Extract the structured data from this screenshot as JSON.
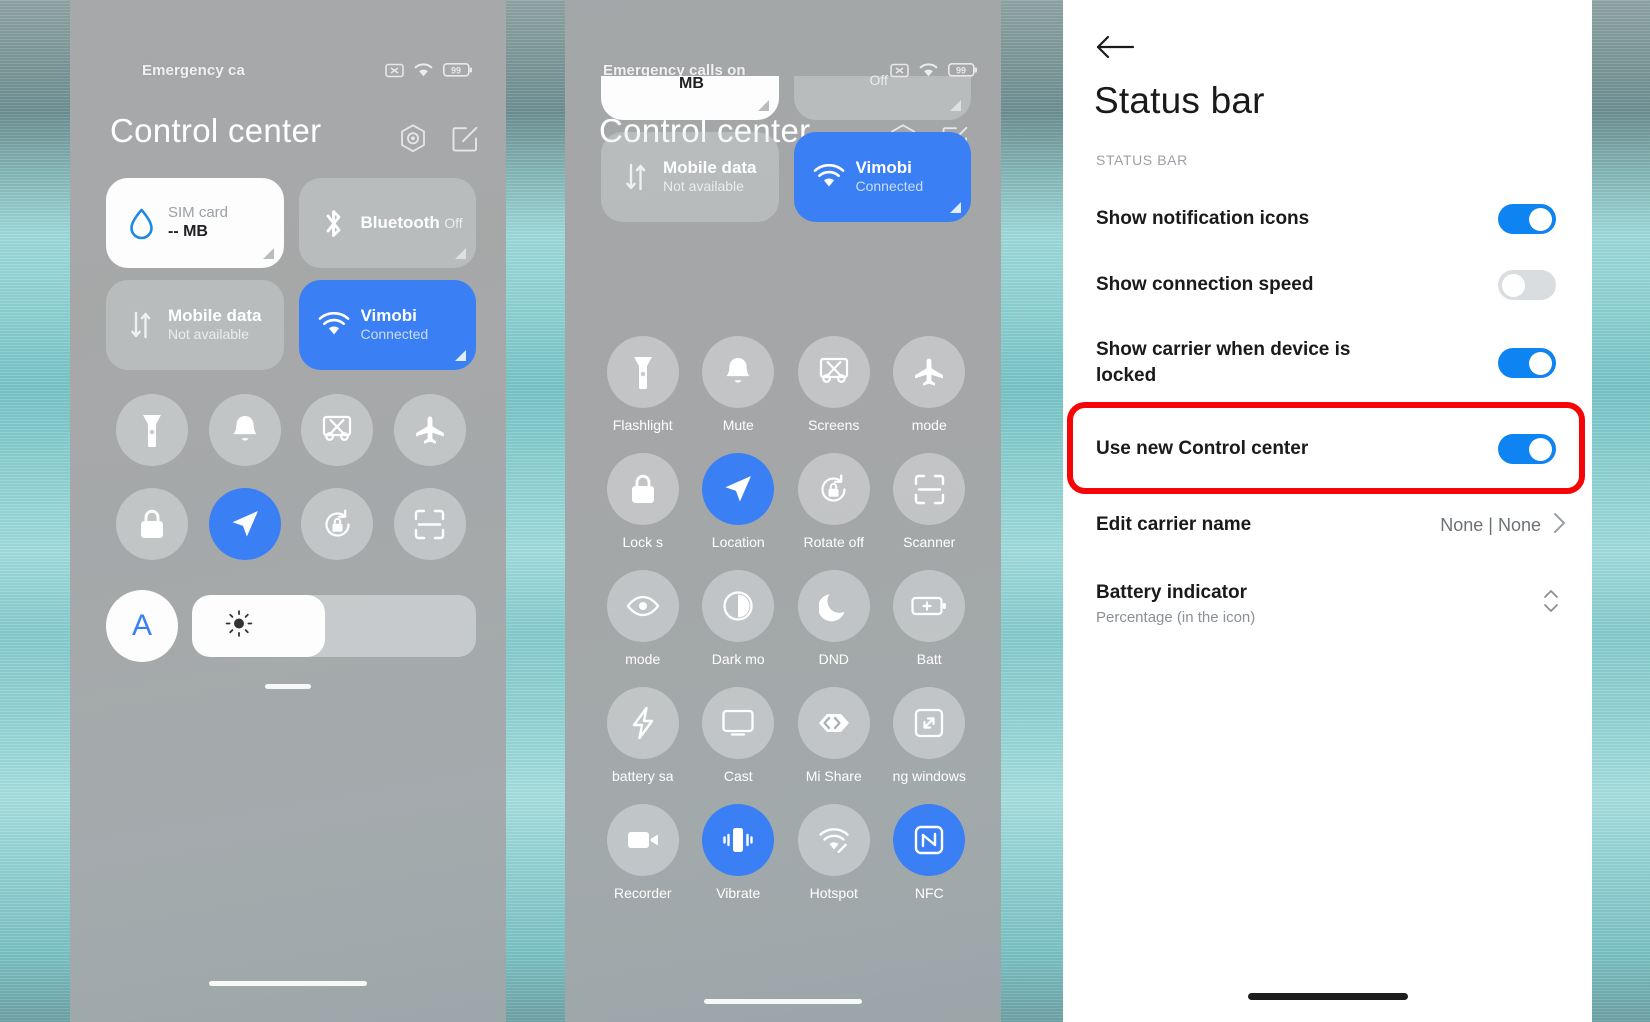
{
  "wallpaper": {
    "color_top": "#8fa5a5",
    "color_mid": "#8fd3d4",
    "color_bottom": "#6fa3a6"
  },
  "accent": {
    "blue": "#3b7ff5",
    "toggle_blue": "#0d84f2",
    "highlight_red": "#f50505"
  },
  "phone1": {
    "status_bar": {
      "carrier": "Emergency ca",
      "battery": "99",
      "icons": [
        "sim-off-icon",
        "wifi-icon",
        "battery-icon"
      ]
    },
    "header": {
      "title": "Control center",
      "icons": [
        "settings-hex-icon",
        "edit-icon"
      ]
    },
    "big_tiles": [
      {
        "title": "SIM card",
        "subtitle": "-- MB",
        "icon": "data-drop-icon",
        "state": "white"
      },
      {
        "title": "Bluetooth",
        "subtitle": "Off",
        "icon": "bluetooth-icon",
        "state": "dim"
      },
      {
        "title": "Mobile data",
        "subtitle": "Not available",
        "icon": "mobile-data-icon",
        "state": "dim"
      },
      {
        "title": "Vimobi",
        "subtitle": "Connected",
        "icon": "wifi-icon",
        "state": "on"
      }
    ],
    "round_tiles": [
      {
        "icon": "flashlight-icon",
        "on": false
      },
      {
        "icon": "bell-icon",
        "on": false
      },
      {
        "icon": "screenshot-icon",
        "on": false
      },
      {
        "icon": "airplane-icon",
        "on": false
      },
      {
        "icon": "lock-icon",
        "on": false
      },
      {
        "icon": "location-icon",
        "on": true
      },
      {
        "icon": "rotate-lock-icon",
        "on": false
      },
      {
        "icon": "scanner-icon",
        "on": false
      }
    ],
    "brightness": {
      "auto_label": "A",
      "level_percent": 47,
      "icon": "sun-icon"
    }
  },
  "phone2": {
    "status_bar": {
      "carrier": "Emergency calls on",
      "battery": "99",
      "icons": [
        "sim-off-icon",
        "wifi-icon",
        "battery-icon"
      ]
    },
    "header": {
      "title": "Control center",
      "icons": [
        "settings-hex-icon",
        "edit-icon"
      ]
    },
    "big_tiles": [
      {
        "title": "",
        "subtitle": "MB",
        "icon": "data-drop-icon",
        "state": "white"
      },
      {
        "title": "",
        "subtitle": "Off",
        "icon": "bluetooth-icon",
        "state": "dim"
      },
      {
        "title": "Mobile data",
        "subtitle": "Not available",
        "icon": "mobile-data-icon",
        "state": "dim"
      },
      {
        "title": "Vimobi",
        "subtitle": "Connected",
        "icon": "wifi-icon",
        "state": "on"
      }
    ],
    "round_tiles": [
      {
        "label": "Flashlight",
        "icon": "flashlight-icon",
        "on": false
      },
      {
        "label": "Mute",
        "icon": "bell-icon",
        "on": false
      },
      {
        "label": "Screens",
        "icon": "screenshot-icon",
        "on": false
      },
      {
        "label": "mode",
        "icon": "airplane-icon",
        "on": false
      },
      {
        "label": "Lock s",
        "icon": "lock-icon",
        "on": false
      },
      {
        "label": "Location",
        "icon": "location-icon",
        "on": true
      },
      {
        "label": "Rotate off",
        "icon": "rotate-lock-icon",
        "on": false
      },
      {
        "label": "Scanner",
        "icon": "scanner-icon",
        "on": false
      },
      {
        "label": "mode",
        "icon": "eye-icon",
        "on": false
      },
      {
        "label": "Dark mo",
        "icon": "contrast-icon",
        "on": false
      },
      {
        "label": "DND",
        "icon": "moon-icon",
        "on": false
      },
      {
        "label": "Batt",
        "icon": "battery-plus-icon",
        "on": false
      },
      {
        "label": "battery sa",
        "icon": "bolt-icon",
        "on": false
      },
      {
        "label": "Cast",
        "icon": "cast-icon",
        "on": false
      },
      {
        "label": "Mi Share",
        "icon": "mishare-icon",
        "on": false
      },
      {
        "label": "ng windows",
        "icon": "float-window-icon",
        "on": false
      },
      {
        "label": "Recorder",
        "icon": "video-icon",
        "on": false
      },
      {
        "label": "Vibrate",
        "icon": "vibrate-icon",
        "on": true
      },
      {
        "label": "Hotspot",
        "icon": "hotspot-icon",
        "on": false
      },
      {
        "label": "NFC",
        "icon": "nfc-icon",
        "on": true
      }
    ]
  },
  "phone3": {
    "back_icon": "back-arrow-icon",
    "title": "Status bar",
    "section_header": "STATUS BAR",
    "rows": [
      {
        "label": "Show notification icons",
        "sub": "",
        "control": "toggle",
        "value": "on"
      },
      {
        "label": "Show connection speed",
        "sub": "",
        "control": "toggle",
        "value": "off"
      },
      {
        "label": "Show carrier when device is locked",
        "sub": "",
        "control": "toggle",
        "value": "on"
      },
      {
        "label": "Use new Control center",
        "sub": "",
        "control": "toggle",
        "value": "on",
        "highlighted": true
      },
      {
        "label": "Edit carrier name",
        "sub": "",
        "control": "value-chevron",
        "value": "None | None"
      },
      {
        "label": "Battery indicator",
        "sub": "Percentage (in the icon)",
        "control": "stepper",
        "value": ""
      }
    ]
  }
}
